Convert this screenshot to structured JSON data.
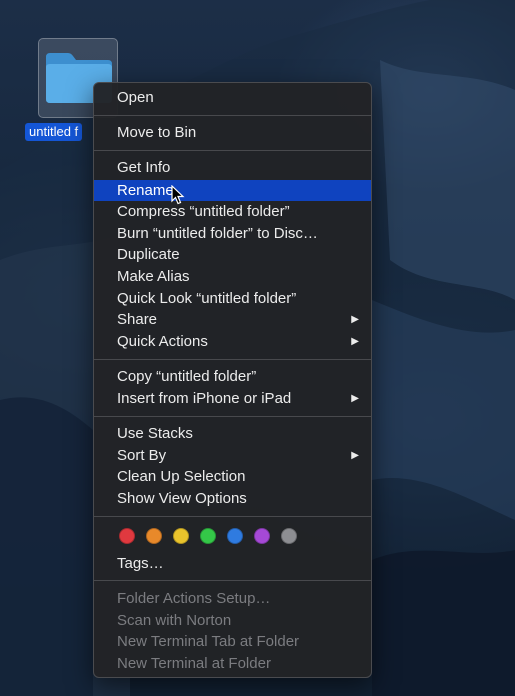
{
  "desktop": {
    "folder_icon": "folder-icon",
    "folder_label": "untitled f",
    "selection_color": "#1456d6"
  },
  "context_menu": {
    "groups": [
      {
        "items": [
          {
            "label": "Open"
          }
        ]
      },
      {
        "items": [
          {
            "label": "Move to Bin"
          }
        ]
      },
      {
        "items": [
          {
            "label": "Get Info"
          },
          {
            "label": "Rename",
            "highlighted": true
          },
          {
            "label": "Compress “untitled folder”"
          },
          {
            "label": "Burn “untitled folder” to Disc…"
          },
          {
            "label": "Duplicate"
          },
          {
            "label": "Make Alias"
          },
          {
            "label": "Quick Look “untitled folder”"
          },
          {
            "label": "Share",
            "submenu": true
          },
          {
            "label": "Quick Actions",
            "submenu": true
          }
        ]
      },
      {
        "items": [
          {
            "label": "Copy “untitled folder”"
          },
          {
            "label": "Insert from iPhone or iPad",
            "submenu": true
          }
        ]
      },
      {
        "items": [
          {
            "label": "Use Stacks"
          },
          {
            "label": "Sort By",
            "submenu": true
          },
          {
            "label": "Clean Up Selection"
          },
          {
            "label": "Show View Options"
          }
        ]
      },
      {
        "tags": {
          "colors": [
            {
              "name": "red",
              "hex": "#e0393f"
            },
            {
              "name": "orange",
              "hex": "#e8892a"
            },
            {
              "name": "yellow",
              "hex": "#e9c32c"
            },
            {
              "name": "green",
              "hex": "#34c748"
            },
            {
              "name": "blue",
              "hex": "#2f7be0"
            },
            {
              "name": "purple",
              "hex": "#a549d6"
            },
            {
              "name": "gray",
              "hex": "#8d8e92"
            }
          ],
          "label": "Tags…"
        }
      },
      {
        "items": [
          {
            "label": "Folder Actions Setup…",
            "disabled": true
          },
          {
            "label": "Scan with Norton",
            "disabled": true
          },
          {
            "label": "New Terminal Tab at Folder",
            "disabled": true
          },
          {
            "label": "New Terminal at Folder",
            "disabled": true
          }
        ]
      }
    ],
    "highlight_color": "#0f43bf",
    "submenu_icon": "chevron-right-icon"
  },
  "cursor_icon": "pointer-cursor-icon"
}
